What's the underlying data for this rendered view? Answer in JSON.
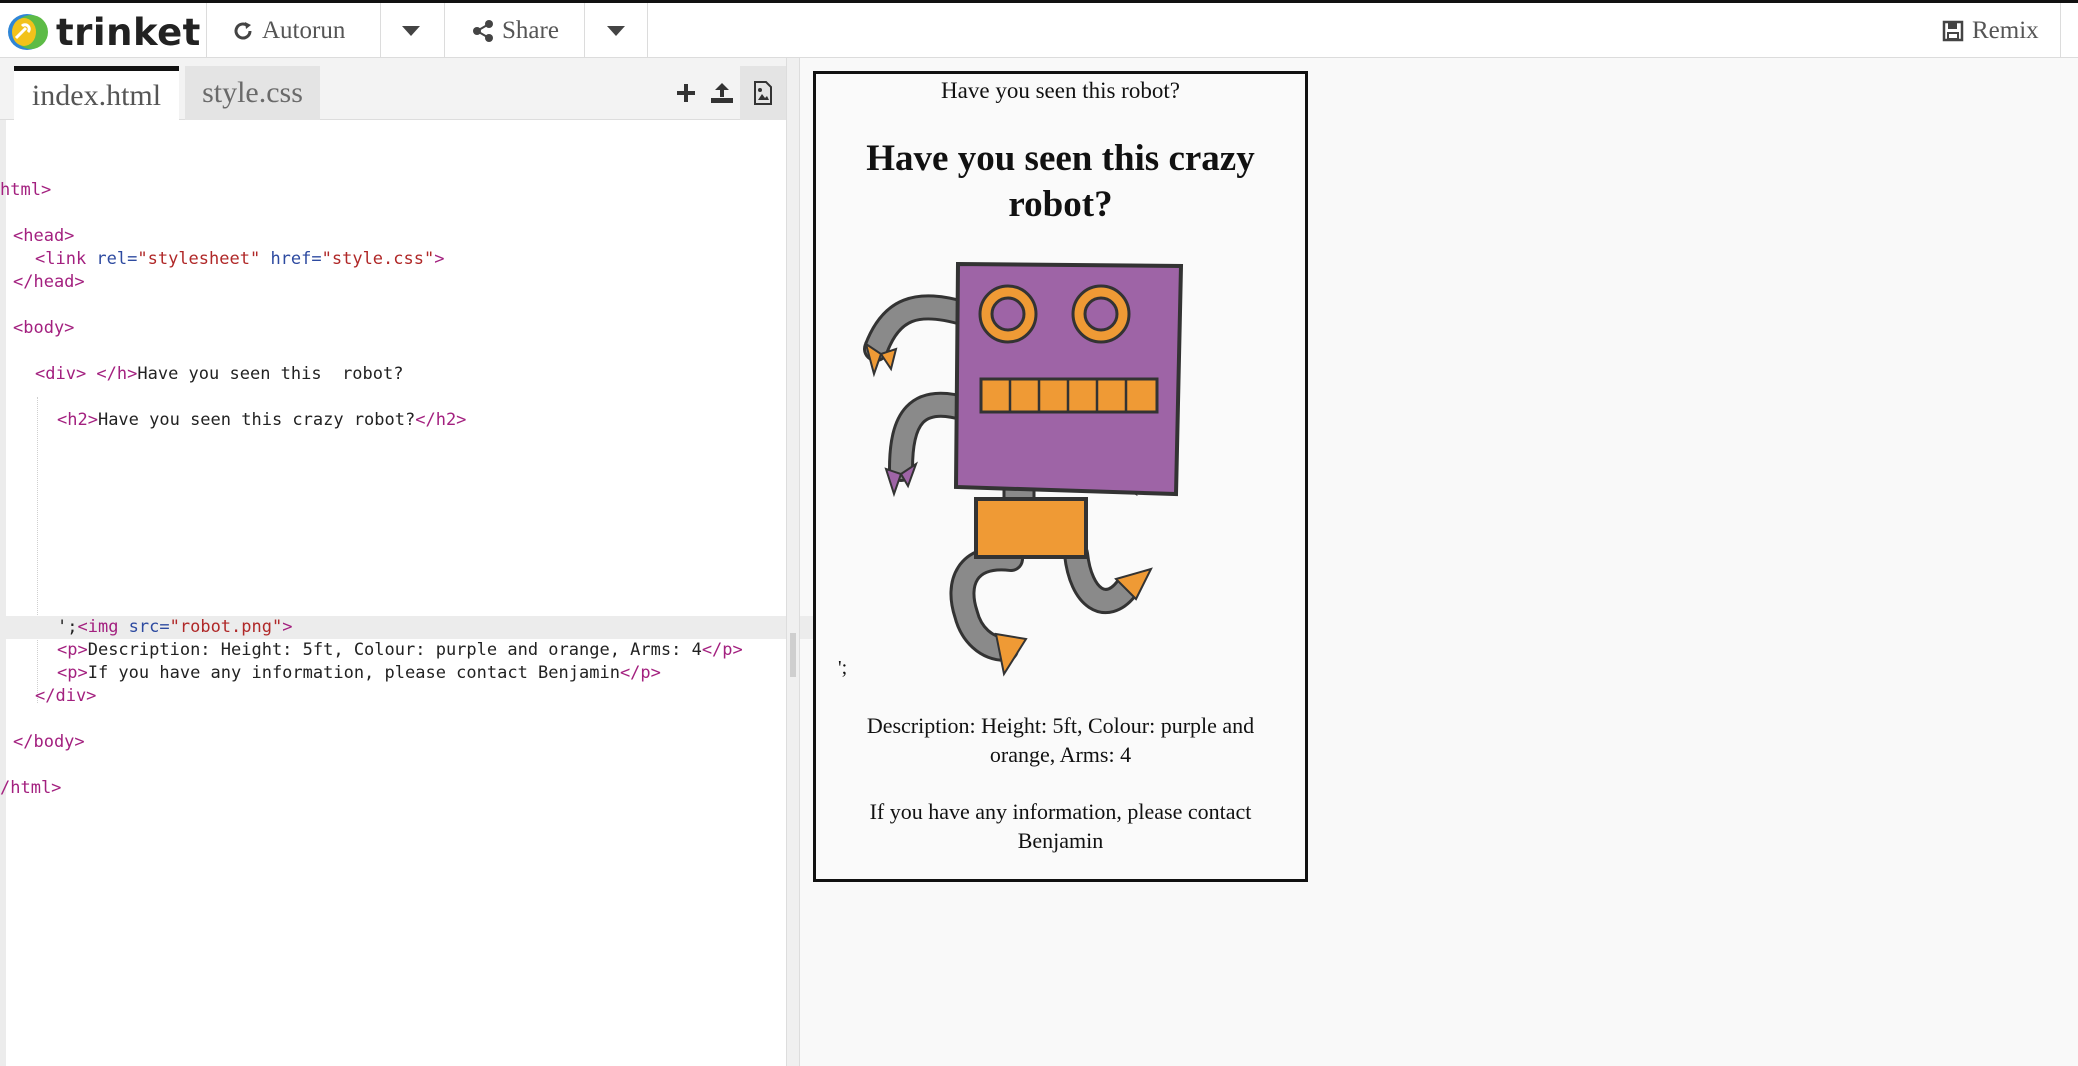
{
  "toolbar": {
    "logo_text": "trinket",
    "autorun_label": "Autorun",
    "share_label": "Share",
    "remix_label": "Remix"
  },
  "editor": {
    "tabs": [
      "index.html",
      "style.css"
    ],
    "tools": [
      "plus-icon",
      "upload-icon",
      "image-icon"
    ],
    "lines": {
      "l1": "html>",
      "l3": "<head>",
      "l4_a": "<link ",
      "l4_b": "rel=",
      "l4_c": "\"stylesheet\"",
      "l4_d": " href=",
      "l4_e": "\"style.css\"",
      "l4_f": ">",
      "l5": "</head>",
      "l7": "<body>",
      "l9_a": "<div>",
      "l9_b": " </h>",
      "l9_c": "Have you seen this  robot?",
      "l11_a": "<h2>",
      "l11_b": "Have you seen this crazy robot?",
      "l11_c": "</h2>",
      "l20_a": "';",
      "l20_b": "<img ",
      "l20_c": "src=",
      "l20_d": "\"robot.png\"",
      "l20_e": ">",
      "l21_a": "<p>",
      "l21_b": "Description: Height: 5ft, Colour: purple and orange, Arms: 4",
      "l21_c": "</p>",
      "l22_a": "<p>",
      "l22_b": "If you have any information, please contact Benjamin",
      "l22_c": "</p>",
      "l23": "</div>",
      "l25": "</body>",
      "l27": "/html>"
    }
  },
  "preview": {
    "div_text": "Have you seen this robot?",
    "heading_line1": "Have you seen this crazy",
    "heading_line2": "robot?",
    "stray_text": "';",
    "description_line1": "Description: Height: 5ft, Colour: purple and",
    "description_line2": "orange, Arms: 4",
    "contact_line1": "If you have any information, please contact",
    "contact_line2": "Benjamin",
    "robot_colors": {
      "body": "#9e64a6",
      "accent": "#ef9a35",
      "limbs": "#8a8a8a"
    }
  }
}
